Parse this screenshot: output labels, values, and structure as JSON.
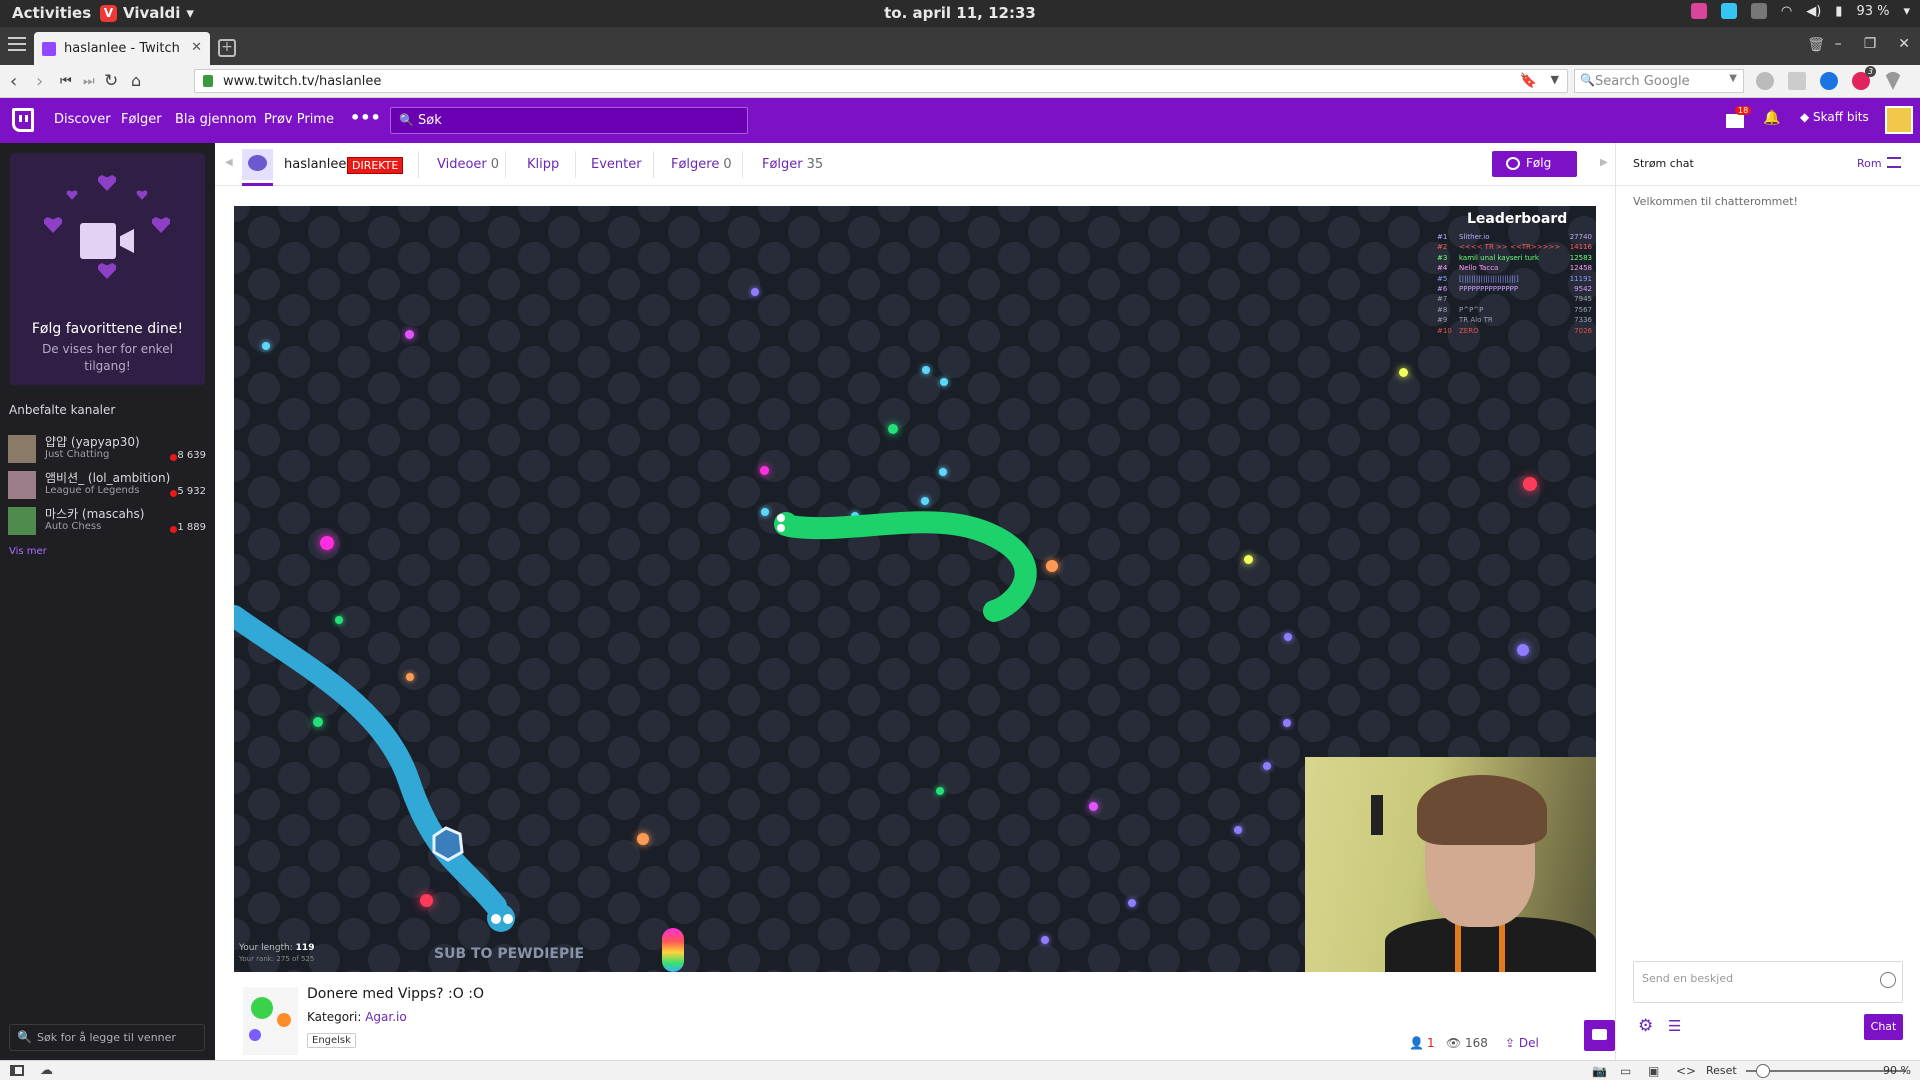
{
  "os": {
    "activities": "Activities",
    "app_name": "Vivaldi",
    "clock": "to. april 11, 12:33",
    "battery": "93 %"
  },
  "browser": {
    "tab_title": "haslanlee - Twitch",
    "url": "www.twitch.tv/haslanlee",
    "search_placeholder": "Search Google",
    "status_reset": "Reset",
    "zoom": "90 %",
    "ext_badge": "3"
  },
  "twitch_nav": {
    "links": [
      "Discover",
      "Følger",
      "Bla gjennom",
      "Prøv Prime"
    ],
    "more": "•••",
    "search_placeholder": "Søk",
    "prime_badge": "18",
    "bits_label": "Skaff bits"
  },
  "sidebar": {
    "promo_title": "Følg favorittene dine!",
    "promo_text": "De vises her for enkel tilgang!",
    "recommended_header": "Anbefalte kanaler",
    "channels": [
      {
        "name": "얍얍 (yapyap30)",
        "game": "Just Chatting",
        "viewers": "8 639"
      },
      {
        "name": "앰비션_ (lol_ambition)",
        "game": "League of Legends",
        "viewers": "5 932"
      },
      {
        "name": "마스카 (mascahs)",
        "game": "Auto Chess",
        "viewers": "1 889"
      }
    ],
    "show_more": "Vis mer",
    "friends_placeholder": "Søk for å legge til venner"
  },
  "channel": {
    "username": "haslanlee",
    "live_badge": "DIREKTE",
    "tabs": [
      {
        "label": "Videoer",
        "count": "0"
      },
      {
        "label": "Klipp",
        "count": ""
      },
      {
        "label": "Eventer",
        "count": ""
      },
      {
        "label": "Følgere",
        "count": "0"
      },
      {
        "label": "Følger",
        "count": "35"
      }
    ],
    "follow_label": "Følg"
  },
  "game_hud": {
    "leaderboard_title": "Leaderboard",
    "leaderboard": [
      {
        "rank": "#1",
        "name": "Slither.io",
        "score": "27740",
        "color": "#b9a8ff"
      },
      {
        "rank": "#2",
        "name": "<<<< TR >> <<TR>>>>>",
        "score": "14116",
        "color": "#ff5a5a"
      },
      {
        "rank": "#3",
        "name": "kamil  unal kayseri turk",
        "score": "12583",
        "color": "#6cff7a"
      },
      {
        "rank": "#4",
        "name": "Nello Tacca",
        "score": "12458",
        "color": "#ff9cf2"
      },
      {
        "rank": "#5",
        "name": "[|||||||||||||||||||||||]",
        "score": "11191",
        "color": "#8f9cff"
      },
      {
        "rank": "#6",
        "name": "PPPPPPPPPPPPPP",
        "score": "9542",
        "color": "#cfa0ff"
      },
      {
        "rank": "#7",
        "name": "",
        "score": "7945",
        "color": "#9aa0b0"
      },
      {
        "rank": "#8",
        "name": "P^P^P",
        "score": "7567",
        "color": "#9aa0b0"
      },
      {
        "rank": "#9",
        "name": "TR Alo TR",
        "score": "7336",
        "color": "#9aa0b0"
      },
      {
        "rank": "#10",
        "name": "ZERO",
        "score": "7026",
        "color": "#e05050"
      }
    ],
    "length_label": "Your length:",
    "length_value": "119",
    "rank_text": "Your rank: 275 of 525",
    "watermark": "SUB TO PEWDIEPIE"
  },
  "stream_info": {
    "title": "Donere med Vipps? :O :O",
    "category_label": "Kategori:",
    "category": "Agar.io",
    "language": "Engelsk",
    "followers_count": "1",
    "viewers": "168",
    "share_label": "Del"
  },
  "chat": {
    "header": "Strøm chat",
    "rooms_label": "Rom",
    "welcome": "Velkommen til chatterommet!",
    "input_placeholder": "Send en beskjed",
    "send_label": "Chat"
  }
}
